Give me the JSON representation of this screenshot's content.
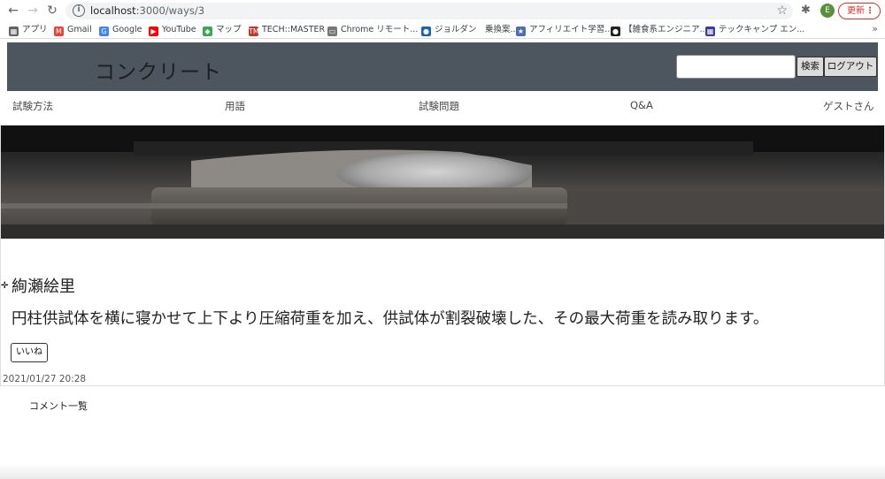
{
  "browser": {
    "url_host": "localhost",
    "url_path": ":3000/ways/3",
    "profile_initial": "E",
    "update_label": "更新",
    "bookmarks": [
      {
        "label": "アプリ",
        "icon": "apps-icon",
        "color": "#5f6368"
      },
      {
        "label": "Gmail",
        "icon": "gmail-icon",
        "color": "#ea4335"
      },
      {
        "label": "Google",
        "icon": "google-icon",
        "color": "#4285f4"
      },
      {
        "label": "YouTube",
        "icon": "youtube-icon",
        "color": "#ff0000"
      },
      {
        "label": "マップ",
        "icon": "maps-icon",
        "color": "#34a853"
      },
      {
        "label": "TECH::MASTER",
        "icon": "techmaster-icon",
        "color": "#c0392b"
      },
      {
        "label": "Chrome リモート...",
        "icon": "remote-desktop-icon",
        "color": "#777777"
      },
      {
        "label": "ジョルダン　乗換案...",
        "icon": "jorudan-icon",
        "color": "#1565c0"
      },
      {
        "label": "アフィリエイト学習...",
        "icon": "affiliate-icon",
        "color": "#4a6fb5"
      },
      {
        "label": "【雑食系エンジニア...",
        "icon": "engineer-icon",
        "color": "#222222"
      },
      {
        "label": "テックキャンプ エン...",
        "icon": "techcamp-icon",
        "color": "#3f3d9b"
      }
    ],
    "more": "»"
  },
  "header": {
    "title": "コンクリート",
    "search_button": "検索",
    "logout_button": "ログアウト"
  },
  "nav": {
    "items": [
      "試験方法",
      "用語",
      "試験問題",
      "Q&A"
    ],
    "user": "ゲストさん"
  },
  "post": {
    "author": "絢瀬絵里",
    "body": "円柱供試体を横に寝かせて上下より圧縮荷重を加え、供試体が割裂破壊した、その最大荷重を読み取ります。",
    "like_button": "いいね",
    "date": "2021/01/27 20:28"
  },
  "comments": {
    "title": "コメント一覧"
  }
}
